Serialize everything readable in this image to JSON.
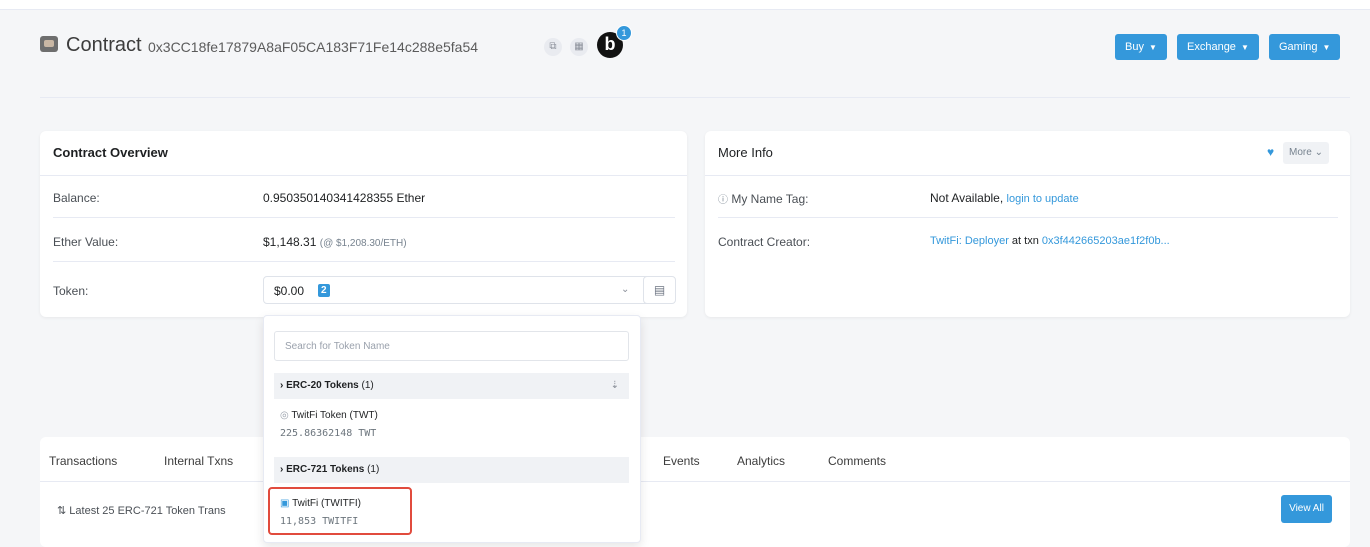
{
  "header": {
    "title": "Contract",
    "address": "0x3CC18fe17879A8aF05CA183F71Fe14c288e5fa54",
    "blockscan_badge": "1",
    "nav": [
      {
        "label": "Buy"
      },
      {
        "label": "Exchange"
      },
      {
        "label": "Gaming"
      }
    ]
  },
  "overview": {
    "title": "Contract Overview",
    "balance_label": "Balance:",
    "balance_value": "0.950350140341428355 Ether",
    "ether_value_label": "Ether Value:",
    "ether_value": "$1,148.31",
    "ether_price": "(@ $1,208.30/ETH)",
    "token_label": "Token:",
    "token_value": "$0.00",
    "token_count": "2"
  },
  "more_info": {
    "title": "More Info",
    "more_label": "More",
    "name_tag_label": "My Name Tag:",
    "name_tag_value": "Not Available,",
    "name_tag_link": "login to update",
    "creator_label": "Contract Creator:",
    "creator_name": "TwitFi: Deployer",
    "creator_at": "at txn",
    "creator_txn": "0x3f442665203ae1f2f0b..."
  },
  "token_dropdown": {
    "search_placeholder": "Search for Token Name",
    "groups": [
      {
        "title": "ERC-20 Tokens",
        "count": "(1)",
        "item_name": "TwitFi Token (TWT)",
        "item_value": "225.86362148 TWT"
      },
      {
        "title": "ERC-721 Tokens",
        "count": "(1)",
        "item_name": "TwitFi (TWITFI)",
        "item_value": "11,853 TWITFI"
      }
    ]
  },
  "tabs": {
    "items": [
      "Transactions",
      "Internal Txns",
      "Events",
      "Analytics",
      "Comments"
    ],
    "latest_text": "Latest 25 ERC-721 Token Trans",
    "view_all": "View All"
  },
  "colors": {
    "accent": "#3498db",
    "highlight": "#e14b3d"
  }
}
